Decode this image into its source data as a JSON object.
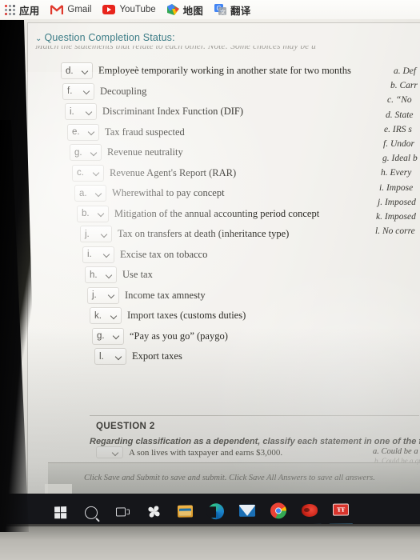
{
  "browser": {
    "bookmarks": [
      {
        "icon": "apps-grid-icon",
        "label": "应用"
      },
      {
        "icon": "gmail-icon",
        "label": "Gmail"
      },
      {
        "icon": "youtube-icon",
        "label": "YouTube"
      },
      {
        "icon": "google-maps-icon",
        "label": "地图"
      },
      {
        "icon": "google-translate-icon",
        "label": "翻译"
      }
    ]
  },
  "page": {
    "completion_status": "Question Completion Status:",
    "completion_caret": "⌄",
    "instruction": "Match the statements that relate to each other. Note: Some choices may be u",
    "matching_rows": [
      {
        "answer": "d.",
        "statement": "Employeè temporarily working in another state for two months"
      },
      {
        "answer": "f.",
        "statement": "Decoupling"
      },
      {
        "answer": "i.",
        "statement": "Discriminant Index Function (DIF)"
      },
      {
        "answer": "e.",
        "statement": "Tax fraud suspected"
      },
      {
        "answer": "g.",
        "statement": "Revenue neutrality"
      },
      {
        "answer": "c.",
        "statement": "Revenue Agent's Report (RAR)"
      },
      {
        "answer": "a.",
        "statement": "Wherewithal to pay concept"
      },
      {
        "answer": "b.",
        "statement": "Mitigation of the annual accounting period concept"
      },
      {
        "answer": "j.",
        "statement": "Tax on transfers at death (inheritance type)"
      },
      {
        "answer": "i.",
        "statement": "Excise tax on tobacco"
      },
      {
        "answer": "h.",
        "statement": "Use tax"
      },
      {
        "answer": "j.",
        "statement": "Income tax amnesty"
      },
      {
        "answer": "k.",
        "statement": "Import taxes (customs duties)"
      },
      {
        "answer": "g.",
        "statement": "“Pay as you go” (paygo)"
      },
      {
        "answer": "l.",
        "statement": "Export taxes"
      }
    ],
    "answer_choices": [
      {
        "key": "a.",
        "text": "Def"
      },
      {
        "key": "b.",
        "text": "Carr"
      },
      {
        "key": "c.",
        "text": "“No"
      },
      {
        "key": "d.",
        "text": "State"
      },
      {
        "key": "e.",
        "text": "IRS s"
      },
      {
        "key": "f.",
        "text": "Undor"
      },
      {
        "key": "g.",
        "text": "Ideal b"
      },
      {
        "key": "h.",
        "text": "Every"
      },
      {
        "key": "i.",
        "text": "Impose"
      },
      {
        "key": "j.",
        "text": "Imposed"
      },
      {
        "key": "k.",
        "text": "Imposed"
      },
      {
        "key": "l.",
        "text": "No corre"
      }
    ],
    "question2": {
      "title": "QUESTION 2",
      "prompt": "Regarding classification as a dependent, classify each statement in one of the four categor",
      "row_answer": "",
      "row_statement": "A son lives with taxpayer and earns $3,000.",
      "choice_a": "a. Could be a qualif",
      "choice_b": "b. Could be a qualif"
    },
    "footer_note": "Click Save and Submit to save and submit. Click Save All Answers to save all answers."
  },
  "taskbar": {
    "items": [
      {
        "icon": "windows-start-icon",
        "label": "Start"
      },
      {
        "icon": "search-icon",
        "label": "Search"
      },
      {
        "icon": "task-view-icon",
        "label": "Task View"
      },
      {
        "icon": "fan-app-icon",
        "label": "App"
      },
      {
        "icon": "file-explorer-icon",
        "label": "File Explorer"
      },
      {
        "icon": "microsoft-edge-icon",
        "label": "Microsoft Edge"
      },
      {
        "icon": "mail-icon",
        "label": "Mail"
      },
      {
        "icon": "google-chrome-icon",
        "label": "Google Chrome"
      },
      {
        "icon": "pdf-reader-icon",
        "label": "PDF Reader"
      },
      {
        "icon": "red-app-icon",
        "label": "App"
      }
    ]
  },
  "colors": {
    "status_teal": "#3b7c86",
    "taskbar_bg": "#15161a",
    "page_bg": "#efedE8"
  }
}
